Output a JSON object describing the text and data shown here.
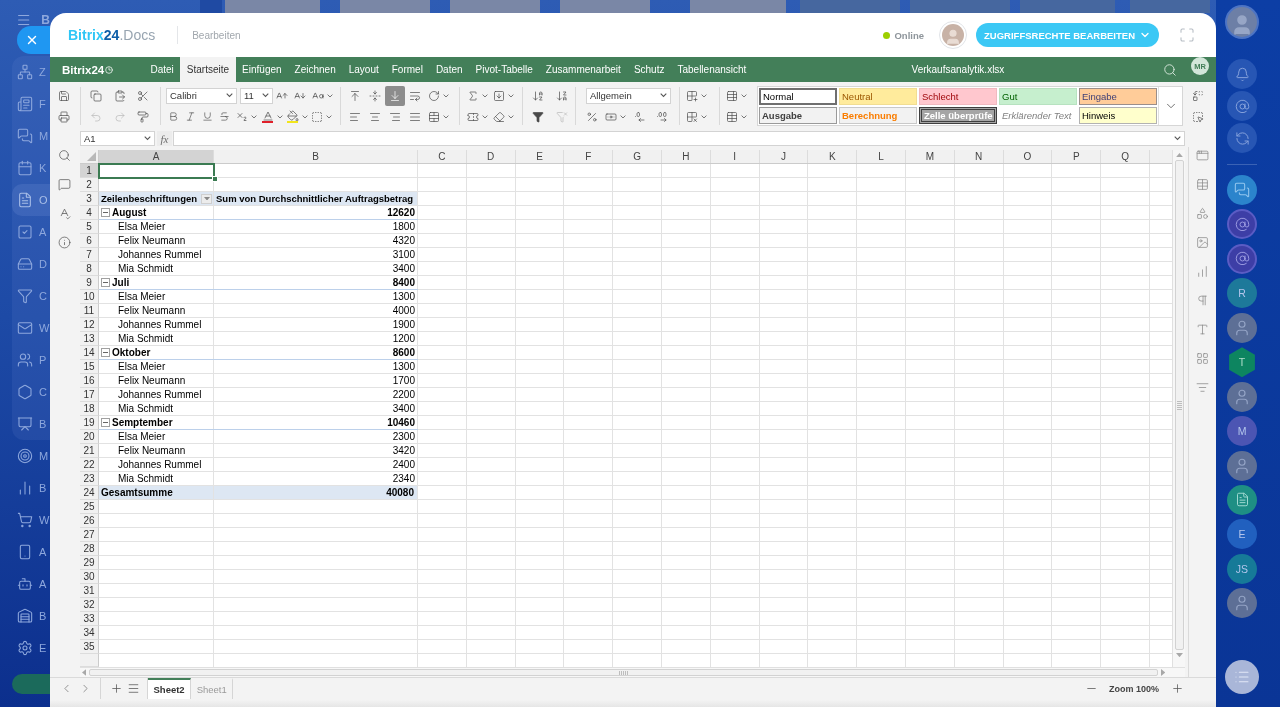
{
  "left_nav": {
    "title": "B",
    "group_items": [
      {
        "label": "Z",
        "selected": false
      },
      {
        "label": "F",
        "selected": false
      },
      {
        "label": "M",
        "selected": false
      },
      {
        "label": "K",
        "selected": false
      },
      {
        "label": "O",
        "selected": true
      },
      {
        "label": "A",
        "selected": false
      },
      {
        "label": "D",
        "selected": false
      },
      {
        "label": "C",
        "selected": false
      },
      {
        "label": "W",
        "selected": false
      },
      {
        "label": "P",
        "selected": false
      },
      {
        "label": "C",
        "selected": false
      },
      {
        "label": "B",
        "selected": false
      }
    ],
    "items": [
      {
        "label": "M",
        "selected": false
      },
      {
        "label": "B",
        "selected": false
      },
      {
        "label": "W",
        "selected": false
      },
      {
        "label": "A",
        "selected": false
      },
      {
        "label": "A",
        "selected": false
      },
      {
        "label": "B",
        "selected": false
      },
      {
        "label": "E",
        "selected": false
      }
    ]
  },
  "header": {
    "logo": {
      "brand": "Bitrix",
      "number": "24",
      "product": ".Docs"
    },
    "mode": "Bearbeiten",
    "status": {
      "label": "Online",
      "online": true
    },
    "access_button": "ZUGRIFFSRECHTE BEARBEITEN"
  },
  "menu_bar": {
    "logo": "Bitrix24",
    "tabs": [
      {
        "label": "Datei",
        "selected": false
      },
      {
        "label": "Startseite",
        "selected": true
      },
      {
        "label": "Einfügen",
        "selected": false
      },
      {
        "label": "Zeichnen",
        "selected": false
      },
      {
        "label": "Layout",
        "selected": false
      },
      {
        "label": "Formel",
        "selected": false
      },
      {
        "label": "Daten",
        "selected": false
      },
      {
        "label": "Pivot-Tabelle",
        "selected": false
      },
      {
        "label": "Zusammenarbeit",
        "selected": false
      },
      {
        "label": "Schutz",
        "selected": false
      },
      {
        "label": "Tabellenansicht",
        "selected": false
      }
    ],
    "file_name": "Verkaufsanalytik.xlsx",
    "user_initials": "MR"
  },
  "toolbar": {
    "font": "Calibri",
    "font_size": "11",
    "number_format": "Allgemein",
    "undo": {
      "disabled": true
    },
    "redo": {
      "disabled": true
    },
    "clear_filter": {
      "disabled": true
    },
    "vertical_align": [
      {
        "selected": false
      },
      {
        "selected": false
      },
      {
        "selected": true
      }
    ],
    "cell_styles": [
      {
        "label": "Normal",
        "kind": "normal",
        "selected": true
      },
      {
        "label": "Neutral",
        "kind": "neutral",
        "selected": false
      },
      {
        "label": "Schlecht",
        "kind": "bad",
        "selected": false
      },
      {
        "label": "Gut",
        "kind": "good",
        "selected": false
      },
      {
        "label": "Eingabe",
        "kind": "input",
        "selected": false
      },
      {
        "label": "Ausgabe",
        "kind": "output",
        "selected": false
      },
      {
        "label": "Berechnung",
        "kind": "calculation",
        "selected": false
      },
      {
        "label": "Zelle überprüfe",
        "kind": "check",
        "selected": false
      },
      {
        "label": "Erklärender Text",
        "kind": "explanatory",
        "selected": false
      },
      {
        "label": "Hinweis",
        "kind": "note",
        "selected": false
      }
    ]
  },
  "formula_bar": {
    "cell": "A1",
    "function_label": "fx"
  },
  "sheet": {
    "columns": [
      {
        "label": "A",
        "selected": true
      },
      {
        "label": "B",
        "selected": false
      },
      {
        "label": "C",
        "selected": false
      },
      {
        "label": "D",
        "selected": false
      },
      {
        "label": "E",
        "selected": false
      },
      {
        "label": "F",
        "selected": false
      },
      {
        "label": "G",
        "selected": false
      },
      {
        "label": "H",
        "selected": false
      },
      {
        "label": "I",
        "selected": false
      },
      {
        "label": "J",
        "selected": false
      },
      {
        "label": "K",
        "selected": false
      },
      {
        "label": "L",
        "selected": false
      },
      {
        "label": "M",
        "selected": false
      },
      {
        "label": "N",
        "selected": false
      },
      {
        "label": "O",
        "selected": false
      },
      {
        "label": "P",
        "selected": false
      },
      {
        "label": "Q",
        "selected": false
      }
    ],
    "rows": [
      {
        "number": "1",
        "selected": true,
        "kind": "empty"
      },
      {
        "number": "2",
        "selected": false,
        "kind": "empty"
      },
      {
        "number": "3",
        "selected": false,
        "kind": "header",
        "cells": [
          "Zeilenbeschriftungen",
          "Sum von Durchschnittlicher Auftragsbetrag"
        ]
      },
      {
        "number": "4",
        "selected": false,
        "kind": "group",
        "expanded": true,
        "cells": [
          "August",
          "12620"
        ]
      },
      {
        "number": "5",
        "selected": false,
        "kind": "item",
        "cells": [
          "Elsa Meier",
          "1800"
        ]
      },
      {
        "number": "6",
        "selected": false,
        "kind": "item",
        "cells": [
          "Felix Neumann",
          "4320"
        ]
      },
      {
        "number": "7",
        "selected": false,
        "kind": "item",
        "cells": [
          "Johannes Rummel",
          "3100"
        ]
      },
      {
        "number": "8",
        "selected": false,
        "kind": "item",
        "cells": [
          "Mia Schmidt",
          "3400"
        ]
      },
      {
        "number": "9",
        "selected": false,
        "kind": "group",
        "expanded": true,
        "cells": [
          "Juli",
          "8400"
        ]
      },
      {
        "number": "10",
        "selected": false,
        "kind": "item",
        "cells": [
          "Elsa Meier",
          "1300"
        ]
      },
      {
        "number": "11",
        "selected": false,
        "kind": "item",
        "cells": [
          "Felix Neumann",
          "4000"
        ]
      },
      {
        "number": "12",
        "selected": false,
        "kind": "item",
        "cells": [
          "Johannes Rummel",
          "1900"
        ]
      },
      {
        "number": "13",
        "selected": false,
        "kind": "item",
        "cells": [
          "Mia Schmidt",
          "1200"
        ]
      },
      {
        "number": "14",
        "selected": false,
        "kind": "group",
        "expanded": true,
        "cells": [
          "Oktober",
          "8600"
        ]
      },
      {
        "number": "15",
        "selected": false,
        "kind": "item",
        "cells": [
          "Elsa Meier",
          "1300"
        ]
      },
      {
        "number": "16",
        "selected": false,
        "kind": "item",
        "cells": [
          "Felix Neumann",
          "1700"
        ]
      },
      {
        "number": "17",
        "selected": false,
        "kind": "item",
        "cells": [
          "Johannes Rummel",
          "2200"
        ]
      },
      {
        "number": "18",
        "selected": false,
        "kind": "item",
        "cells": [
          "Mia Schmidt",
          "3400"
        ]
      },
      {
        "number": "19",
        "selected": false,
        "kind": "group",
        "expanded": true,
        "cells": [
          "Semptember",
          "10460"
        ]
      },
      {
        "number": "20",
        "selected": false,
        "kind": "item",
        "cells": [
          "Elsa Meier",
          "2300"
        ]
      },
      {
        "number": "21",
        "selected": false,
        "kind": "item",
        "cells": [
          "Felix Neumann",
          "3420"
        ]
      },
      {
        "number": "22",
        "selected": false,
        "kind": "item",
        "cells": [
          "Johannes Rummel",
          "2400"
        ]
      },
      {
        "number": "23",
        "selected": false,
        "kind": "item",
        "cells": [
          "Mia Schmidt",
          "2340"
        ]
      },
      {
        "number": "24",
        "selected": false,
        "kind": "total",
        "cells": [
          "Gesamtsumme",
          "40080"
        ]
      },
      {
        "number": "25",
        "selected": false,
        "kind": "empty"
      },
      {
        "number": "26",
        "selected": false,
        "kind": "empty"
      },
      {
        "number": "27",
        "selected": false,
        "kind": "empty"
      },
      {
        "number": "28",
        "selected": false,
        "kind": "empty"
      },
      {
        "number": "29",
        "selected": false,
        "kind": "empty"
      },
      {
        "number": "30",
        "selected": false,
        "kind": "empty"
      },
      {
        "number": "31",
        "selected": false,
        "kind": "empty"
      },
      {
        "number": "32",
        "selected": false,
        "kind": "empty"
      },
      {
        "number": "33",
        "selected": false,
        "kind": "empty"
      },
      {
        "number": "34",
        "selected": false,
        "kind": "empty"
      },
      {
        "number": "35",
        "selected": false,
        "kind": "empty"
      }
    ]
  },
  "sheet_tabs": [
    {
      "label": "Sheet2",
      "selected": true
    },
    {
      "label": "Sheet1",
      "selected": false
    }
  ],
  "zoom_label": "Zoom 100%",
  "right_bar": {
    "items": [
      {
        "kind": "chat"
      },
      {
        "kind": "copilot"
      },
      {
        "kind": "copilot"
      },
      {
        "kind": "initials",
        "text": "R",
        "color": "#1d799a"
      },
      {
        "kind": "photo"
      },
      {
        "kind": "group",
        "text": "T",
        "color": "#0d8560"
      },
      {
        "kind": "photo"
      },
      {
        "kind": "initials",
        "text": "M",
        "color": "#4c55b3"
      },
      {
        "kind": "photo"
      },
      {
        "kind": "document"
      },
      {
        "kind": "initials",
        "text": "E",
        "color": "#2160bf"
      },
      {
        "kind": "initials",
        "text": "JS",
        "color": "#167a98"
      },
      {
        "kind": "photo"
      }
    ]
  }
}
